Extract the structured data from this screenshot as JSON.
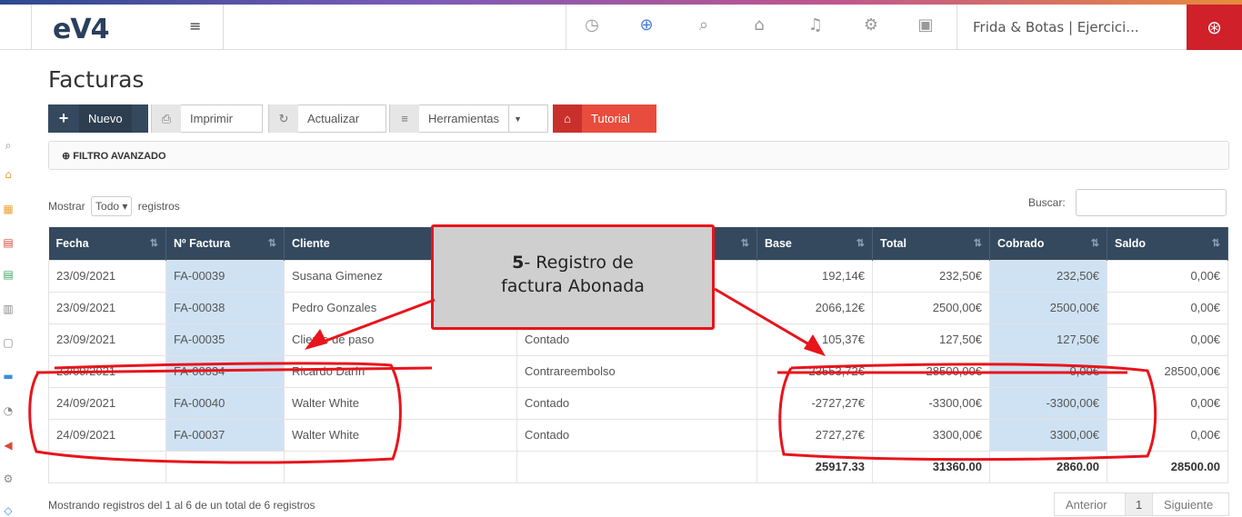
{
  "topbar": {
    "logo": "eV4",
    "menu_icon": "≡",
    "icons": [
      "clock-icon",
      "plus-circle-icon",
      "search-icon",
      "home-icon",
      "bell-icon",
      "gear-icon",
      "briefcase-icon"
    ],
    "company": "Frida & Botas | Ejercici...",
    "help_icon": "lifebuoy-icon"
  },
  "page": {
    "title": "Facturas"
  },
  "toolbar": {
    "new_label": "Nuevo",
    "print_label": "Imprimir",
    "refresh_label": "Actualizar",
    "tools_label": "Herramientas",
    "tutorial_label": "Tutorial"
  },
  "filter": {
    "label": "FILTRO AVANZADO"
  },
  "list_controls": {
    "show_label": "Mostrar",
    "show_value": "Todo",
    "records_label": "registros",
    "search_label": "Buscar:"
  },
  "table": {
    "columns": [
      "Fecha",
      "Nº Factura",
      "Cliente",
      "",
      "Base",
      "Total",
      "Cobrado",
      "Saldo"
    ],
    "rows": [
      {
        "fecha": "23/09/2021",
        "factura": "FA-00039",
        "cliente": "Susana Gimenez",
        "pago": "",
        "base": "192,14€",
        "total": "232,50€",
        "cobrado": "232,50€",
        "saldo": "0,00€"
      },
      {
        "fecha": "23/09/2021",
        "factura": "FA-00038",
        "cliente": "Pedro Gonzales",
        "pago": "",
        "base": "2066,12€",
        "total": "2500,00€",
        "cobrado": "2500,00€",
        "saldo": "0,00€"
      },
      {
        "fecha": "23/09/2021",
        "factura": "FA-00035",
        "cliente": "Cliente de paso",
        "pago": "Contado",
        "base": "105,37€",
        "total": "127,50€",
        "cobrado": "127,50€",
        "saldo": "0,00€"
      },
      {
        "fecha": "23/09/2021",
        "factura": "FA-00034",
        "cliente": "Ricardo Darín",
        "pago": "Contrareembolso",
        "base": "23553,72€",
        "total": "28500,00€",
        "cobrado": "0,00€",
        "saldo": "28500,00€"
      },
      {
        "fecha": "24/09/2021",
        "factura": "FA-00040",
        "cliente": "Walter White",
        "pago": "Contado",
        "base": "-2727,27€",
        "total": "-3300,00€",
        "cobrado": "-3300,00€",
        "saldo": "0,00€"
      },
      {
        "fecha": "24/09/2021",
        "factura": "FA-00037",
        "cliente": "Walter White",
        "pago": "Contado",
        "base": "2727,27€",
        "total": "3300,00€",
        "cobrado": "3300,00€",
        "saldo": "0,00€"
      }
    ],
    "totals": {
      "base": "25917.33",
      "total": "31360.00",
      "cobrado": "2860.00",
      "saldo": "28500.00"
    }
  },
  "footer": {
    "info": "Mostrando registros del 1 al 6 de un total de 6 registros",
    "prev": "Anterior",
    "page": "1",
    "next": "Siguiente"
  },
  "annotation": {
    "number": "5",
    "text_a": "- Registro de",
    "text_b": "factura Abonada"
  },
  "colors": {
    "header_bg": "#34495e",
    "highlight": "#cfe2f3",
    "accent_red": "#e8141c",
    "nuevo": "#34495e",
    "tutorial": "#e74c3c"
  }
}
